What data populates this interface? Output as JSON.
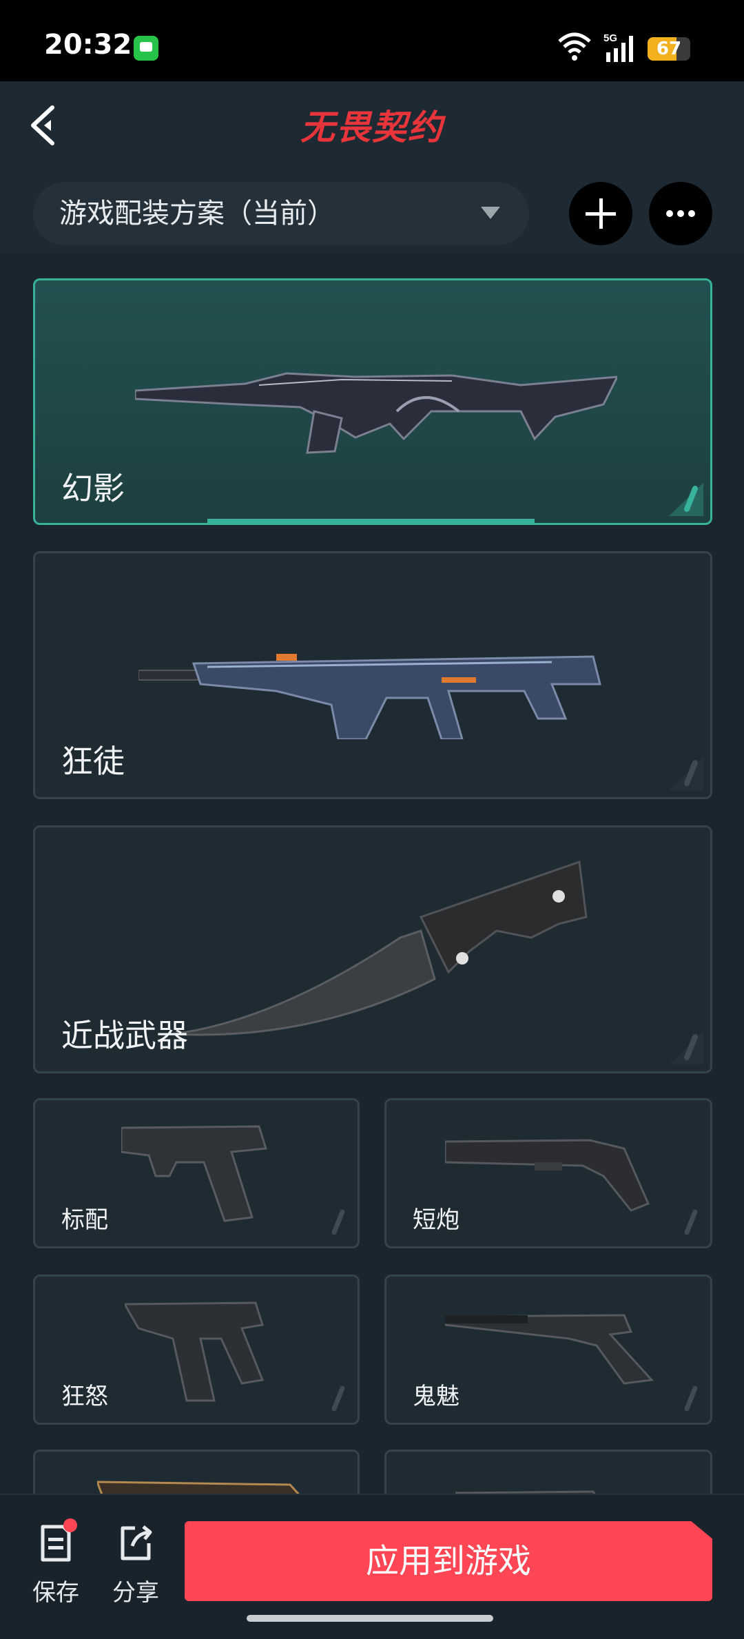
{
  "status_bar": {
    "time": "20:32",
    "network": "5G",
    "battery": "67",
    "battery_level": 0.67
  },
  "header": {
    "logo": "无畏契约"
  },
  "loadout": {
    "current": "游戏配装方案（当前）"
  },
  "weapons_large": [
    {
      "name": "幻影",
      "selected": true
    },
    {
      "name": "狂徒",
      "selected": false
    },
    {
      "name": "近战武器",
      "selected": false
    }
  ],
  "weapons_small": [
    {
      "name": "标配"
    },
    {
      "name": "短炮"
    },
    {
      "name": "狂怒"
    },
    {
      "name": "鬼魅"
    }
  ],
  "bottom_bar": {
    "save_label": "保存",
    "share_label": "分享",
    "apply_label": "应用到游戏"
  },
  "colors": {
    "accent": "#37b39c",
    "brand_red": "#ff4655",
    "background": "#1a252e"
  }
}
